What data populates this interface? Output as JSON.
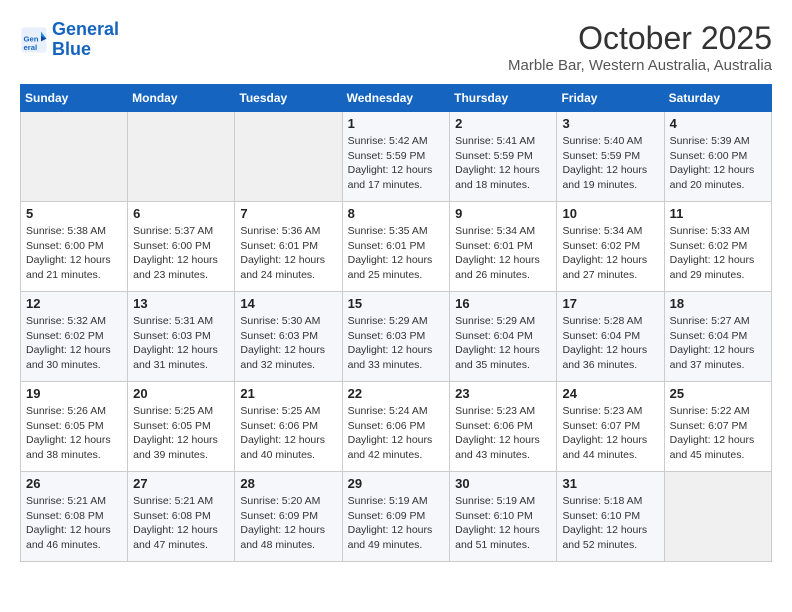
{
  "header": {
    "logo_line1": "General",
    "logo_line2": "Blue",
    "title": "October 2025",
    "subtitle": "Marble Bar, Western Australia, Australia"
  },
  "columns": [
    "Sunday",
    "Monday",
    "Tuesday",
    "Wednesday",
    "Thursday",
    "Friday",
    "Saturday"
  ],
  "weeks": [
    [
      {
        "day": "",
        "info": ""
      },
      {
        "day": "",
        "info": ""
      },
      {
        "day": "",
        "info": ""
      },
      {
        "day": "1",
        "info": "Sunrise: 5:42 AM\nSunset: 5:59 PM\nDaylight: 12 hours\nand 17 minutes."
      },
      {
        "day": "2",
        "info": "Sunrise: 5:41 AM\nSunset: 5:59 PM\nDaylight: 12 hours\nand 18 minutes."
      },
      {
        "day": "3",
        "info": "Sunrise: 5:40 AM\nSunset: 5:59 PM\nDaylight: 12 hours\nand 19 minutes."
      },
      {
        "day": "4",
        "info": "Sunrise: 5:39 AM\nSunset: 6:00 PM\nDaylight: 12 hours\nand 20 minutes."
      }
    ],
    [
      {
        "day": "5",
        "info": "Sunrise: 5:38 AM\nSunset: 6:00 PM\nDaylight: 12 hours\nand 21 minutes."
      },
      {
        "day": "6",
        "info": "Sunrise: 5:37 AM\nSunset: 6:00 PM\nDaylight: 12 hours\nand 23 minutes."
      },
      {
        "day": "7",
        "info": "Sunrise: 5:36 AM\nSunset: 6:01 PM\nDaylight: 12 hours\nand 24 minutes."
      },
      {
        "day": "8",
        "info": "Sunrise: 5:35 AM\nSunset: 6:01 PM\nDaylight: 12 hours\nand 25 minutes."
      },
      {
        "day": "9",
        "info": "Sunrise: 5:34 AM\nSunset: 6:01 PM\nDaylight: 12 hours\nand 26 minutes."
      },
      {
        "day": "10",
        "info": "Sunrise: 5:34 AM\nSunset: 6:02 PM\nDaylight: 12 hours\nand 27 minutes."
      },
      {
        "day": "11",
        "info": "Sunrise: 5:33 AM\nSunset: 6:02 PM\nDaylight: 12 hours\nand 29 minutes."
      }
    ],
    [
      {
        "day": "12",
        "info": "Sunrise: 5:32 AM\nSunset: 6:02 PM\nDaylight: 12 hours\nand 30 minutes."
      },
      {
        "day": "13",
        "info": "Sunrise: 5:31 AM\nSunset: 6:03 PM\nDaylight: 12 hours\nand 31 minutes."
      },
      {
        "day": "14",
        "info": "Sunrise: 5:30 AM\nSunset: 6:03 PM\nDaylight: 12 hours\nand 32 minutes."
      },
      {
        "day": "15",
        "info": "Sunrise: 5:29 AM\nSunset: 6:03 PM\nDaylight: 12 hours\nand 33 minutes."
      },
      {
        "day": "16",
        "info": "Sunrise: 5:29 AM\nSunset: 6:04 PM\nDaylight: 12 hours\nand 35 minutes."
      },
      {
        "day": "17",
        "info": "Sunrise: 5:28 AM\nSunset: 6:04 PM\nDaylight: 12 hours\nand 36 minutes."
      },
      {
        "day": "18",
        "info": "Sunrise: 5:27 AM\nSunset: 6:04 PM\nDaylight: 12 hours\nand 37 minutes."
      }
    ],
    [
      {
        "day": "19",
        "info": "Sunrise: 5:26 AM\nSunset: 6:05 PM\nDaylight: 12 hours\nand 38 minutes."
      },
      {
        "day": "20",
        "info": "Sunrise: 5:25 AM\nSunset: 6:05 PM\nDaylight: 12 hours\nand 39 minutes."
      },
      {
        "day": "21",
        "info": "Sunrise: 5:25 AM\nSunset: 6:06 PM\nDaylight: 12 hours\nand 40 minutes."
      },
      {
        "day": "22",
        "info": "Sunrise: 5:24 AM\nSunset: 6:06 PM\nDaylight: 12 hours\nand 42 minutes."
      },
      {
        "day": "23",
        "info": "Sunrise: 5:23 AM\nSunset: 6:06 PM\nDaylight: 12 hours\nand 43 minutes."
      },
      {
        "day": "24",
        "info": "Sunrise: 5:23 AM\nSunset: 6:07 PM\nDaylight: 12 hours\nand 44 minutes."
      },
      {
        "day": "25",
        "info": "Sunrise: 5:22 AM\nSunset: 6:07 PM\nDaylight: 12 hours\nand 45 minutes."
      }
    ],
    [
      {
        "day": "26",
        "info": "Sunrise: 5:21 AM\nSunset: 6:08 PM\nDaylight: 12 hours\nand 46 minutes."
      },
      {
        "day": "27",
        "info": "Sunrise: 5:21 AM\nSunset: 6:08 PM\nDaylight: 12 hours\nand 47 minutes."
      },
      {
        "day": "28",
        "info": "Sunrise: 5:20 AM\nSunset: 6:09 PM\nDaylight: 12 hours\nand 48 minutes."
      },
      {
        "day": "29",
        "info": "Sunrise: 5:19 AM\nSunset: 6:09 PM\nDaylight: 12 hours\nand 49 minutes."
      },
      {
        "day": "30",
        "info": "Sunrise: 5:19 AM\nSunset: 6:10 PM\nDaylight: 12 hours\nand 51 minutes."
      },
      {
        "day": "31",
        "info": "Sunrise: 5:18 AM\nSunset: 6:10 PM\nDaylight: 12 hours\nand 52 minutes."
      },
      {
        "day": "",
        "info": ""
      }
    ]
  ]
}
